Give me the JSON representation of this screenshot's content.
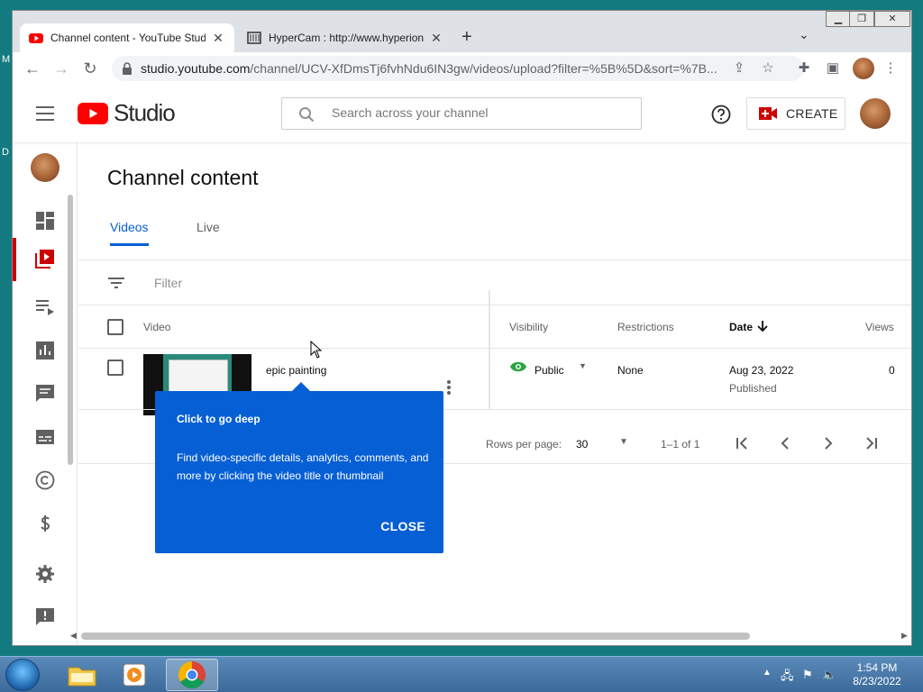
{
  "desktop": {
    "left_letters": [
      "M",
      "D"
    ]
  },
  "browser": {
    "tabs": [
      {
        "title": "Channel content - YouTube Studio",
        "active": true
      },
      {
        "title": "HyperCam : http://www.hyperionics.com",
        "active": false
      }
    ],
    "new_tab": "+",
    "url_host": "studio.youtube.com",
    "url_path": "/channel/UCV-XfDmsTj6fvhNdu6IN3gw/videos/upload?filter=%5B%5D&sort=%7B...",
    "window_controls": [
      "minimize",
      "restore",
      "close"
    ]
  },
  "studio": {
    "logo_text": "Studio",
    "search_placeholder": "Search across your channel",
    "create_label": "CREATE",
    "accent_red": "#cc0000",
    "accent_blue": "#065fd4"
  },
  "sidebar": {
    "items": [
      {
        "name": "dashboard",
        "icon": "dashboard-icon"
      },
      {
        "name": "content",
        "icon": "content-icon",
        "active": true
      },
      {
        "name": "playlists",
        "icon": "playlist-icon"
      },
      {
        "name": "analytics",
        "icon": "analytics-icon"
      },
      {
        "name": "comments",
        "icon": "comments-icon"
      },
      {
        "name": "subtitles",
        "icon": "subtitles-icon"
      },
      {
        "name": "copyright",
        "icon": "copyright-icon"
      },
      {
        "name": "earn",
        "icon": "dollar-icon"
      },
      {
        "name": "settings",
        "icon": "gear-icon"
      },
      {
        "name": "feedback",
        "icon": "feedback-icon"
      }
    ]
  },
  "content": {
    "title": "Channel content",
    "tabs": [
      {
        "label": "Videos",
        "active": true
      },
      {
        "label": "Live",
        "active": false
      }
    ],
    "filter_label": "Filter",
    "columns": {
      "video": "Video",
      "visibility": "Visibility",
      "restrictions": "Restrictions",
      "date": "Date",
      "views": "Views"
    },
    "rows": [
      {
        "title": "epic painting",
        "visibility": "Public",
        "restrictions": "None",
        "date": "Aug 23, 2022",
        "date_status": "Published",
        "views": "0"
      }
    ],
    "pagination": {
      "rows_per_page_label": "Rows per page:",
      "rows_per_page": "30",
      "range": "1–1 of 1"
    }
  },
  "tooltip": {
    "title": "Click to go deep",
    "body": "Find video-specific details, analytics, comments, and more by clicking the video title or thumbnail",
    "close_label": "CLOSE"
  },
  "taskbar": {
    "time": "1:54 PM",
    "date": "8/23/2022"
  }
}
